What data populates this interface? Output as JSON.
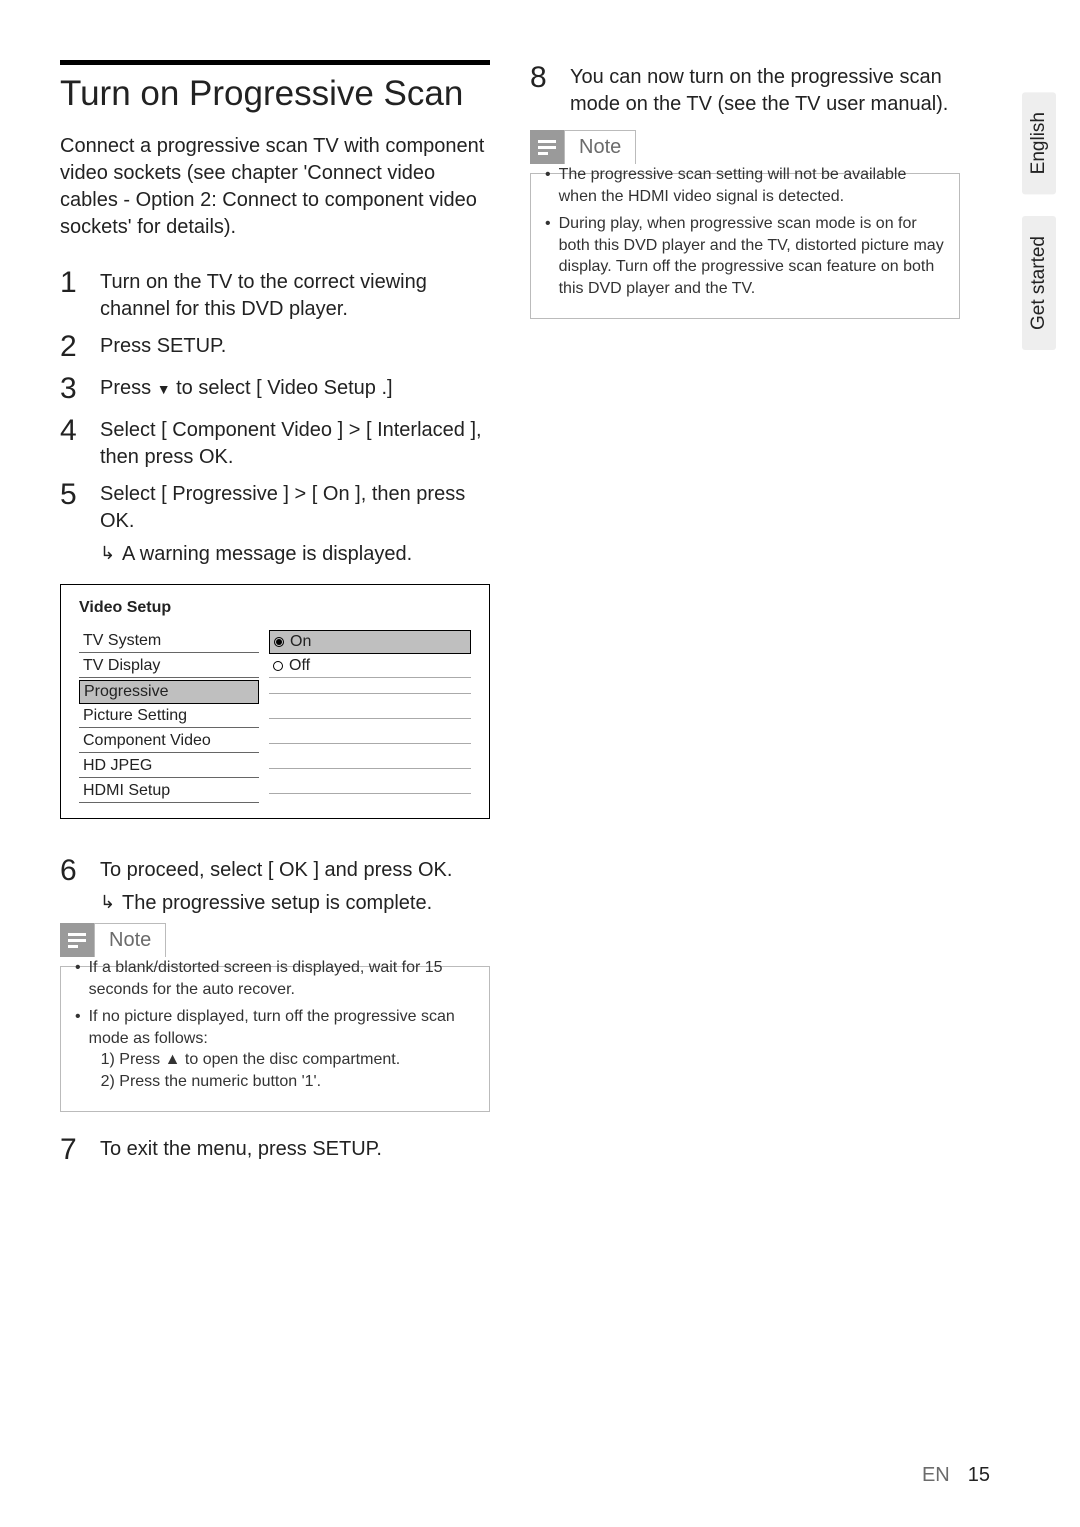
{
  "side_tabs": {
    "lang": "English",
    "section": "Get started"
  },
  "left": {
    "heading": "Turn on Progressive Scan",
    "intro": "Connect a progressive scan TV with component video sockets (see chapter 'Connect video cables - Option 2: Connect to component video sockets' for details).",
    "steps": {
      "s1": "Turn on the TV to the correct viewing channel for this DVD player.",
      "s2_pre": "Press ",
      "s2_b": "SETUP.",
      "s3_pre": "Press ",
      "s3_mid": " to select ",
      "s3_b": "[ Video Setup .]",
      "s4_pre": "Select ",
      "s4_b1": "[ Component Video ]",
      "s4_gt": "> ",
      "s4_b2": "[ Interlaced ]",
      "s4_post": ", then press ",
      "s4_ok": "OK",
      "s4_end": ".",
      "s5_pre": "Select ",
      "s5_b1": "[ Progressive ]",
      "s5_gt": "> ",
      "s5_b2": "[ On ]",
      "s5_post": ", then press ",
      "s5_ok": "OK",
      "s5_end": ".",
      "s5_sub": "A warning message is displayed.",
      "s6_pre": "To proceed, select ",
      "s6_b1": "[ OK ]",
      "s6_mid": " and press ",
      "s6_b2": "OK",
      "s6_end": ".",
      "s6_sub": "The progressive setup is complete.",
      "s7_pre": "To exit the menu, press ",
      "s7_b": "SETUP."
    },
    "menu": {
      "title": "Video Setup",
      "left_items": [
        "TV System",
        "TV Display",
        "Progressive",
        "Picture Setting",
        "Component Video",
        "HD JPEG",
        "HDMI Setup"
      ],
      "selected_left_index": 2,
      "right_on": "On",
      "right_off": "Off"
    },
    "note1": {
      "label": "Note",
      "b1": "If a blank/distorted screen is displayed, wait for 15 seconds for the auto recover.",
      "b2": "If no picture displayed, turn off the progressive scan mode as follows:",
      "b2_1_pre": "1)  Press ",
      "b2_1_post": " to open the disc compartment.",
      "b2_2_pre": "2)  Press the ",
      "b2_2_b": "numeric button '1'",
      "b2_2_post": "."
    }
  },
  "right": {
    "s8": "You can now turn on the progressive scan mode on the TV (see the TV user manual).",
    "note2": {
      "label": "Note",
      "b1": "The progressive scan setting will not be available when the HDMI video signal is detected.",
      "b2": "During play, when progressive scan mode is on for both this DVD player and the TV, distorted picture may display. Turn off the progressive scan feature on both this DVD player and the TV."
    }
  },
  "footer": {
    "lang": "EN",
    "page": "15"
  }
}
